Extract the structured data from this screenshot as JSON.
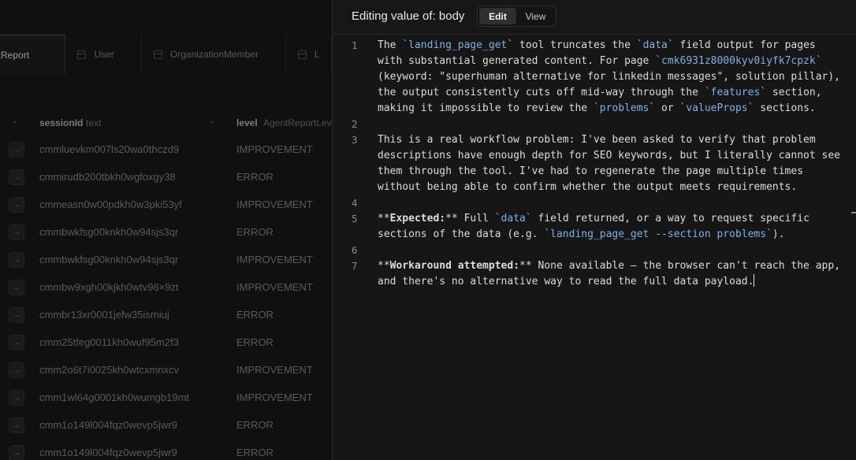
{
  "background": {
    "tabs": [
      {
        "label": "ntReport",
        "active": true
      },
      {
        "label": "User",
        "active": false
      },
      {
        "label": "OrganizationMember",
        "active": false
      },
      {
        "label": "L",
        "active": false
      }
    ],
    "columns": {
      "session_id": {
        "name": "sessionId",
        "type": "text"
      },
      "level": {
        "name": "level",
        "type": "AgentReportLev"
      }
    },
    "rows": [
      {
        "sessionId": "cmmluevkm007ls20wa0thczd9",
        "level": "IMPROVEMENT"
      },
      {
        "sessionId": "cmmirudb200tbkh0wgfoxgy38",
        "level": "ERROR"
      },
      {
        "sessionId": "cmmeasn0w00pdkh0w3pki53yf",
        "level": "IMPROVEMENT"
      },
      {
        "sessionId": "cmmbwkfsg00knkh0w94sjs3qr",
        "level": "ERROR"
      },
      {
        "sessionId": "cmmbwkfsg00knkh0w94sjs3qr",
        "level": "IMPROVEMENT"
      },
      {
        "sessionId": "cmmbw9xgh00kjkh0wtv96×9zt",
        "level": "IMPROVEMENT"
      },
      {
        "sessionId": "cmmbr13xr0001jefw35ismiuj",
        "level": "ERROR"
      },
      {
        "sessionId": "cmm25tfeg0011kh0wuf95m2f3",
        "level": "ERROR"
      },
      {
        "sessionId": "cmm2o6t7i0025kh0wtcxmnxcv",
        "level": "IMPROVEMENT"
      },
      {
        "sessionId": "cmm1wl64g0001kh0wumgb19mt",
        "level": "IMPROVEMENT"
      },
      {
        "sessionId": "cmm1o149l004fqz0wevp5jwr9",
        "level": "ERROR"
      },
      {
        "sessionId": "cmm1o149l004fqz0wevp5jwr9",
        "level": "ERROR"
      }
    ],
    "row_arrow_icon": "arrow-right-icon"
  },
  "editor": {
    "title": "Editing value of: body",
    "mode_edit_label": "Edit",
    "mode_view_label": "View",
    "active_mode": "Edit",
    "line_numbers": [
      "1",
      "2",
      "3",
      "4",
      "5",
      "6",
      "7"
    ],
    "accent_color": "#7fb0e8",
    "lines": [
      [
        {
          "t": "The "
        },
        {
          "t": "`landing_page_get`",
          "c": "tok"
        },
        {
          "t": " tool truncates the "
        },
        {
          "t": "`data`",
          "c": "tok"
        },
        {
          "t": " field output for pages"
        }
      ],
      [
        {
          "t": "with substantial generated content. For page "
        },
        {
          "t": "`cmk6931z8000kyv0iyfk7cpzk`",
          "c": "tok"
        }
      ],
      [
        {
          "t": "(keyword: \"superhuman alternative for linkedin messages\", solution pillar),"
        }
      ],
      [
        {
          "t": "the output consistently cuts off mid-way through the "
        },
        {
          "t": "`features`",
          "c": "tok"
        },
        {
          "t": " section,"
        }
      ],
      [
        {
          "t": "making it impossible to review the "
        },
        {
          "t": "`problems`",
          "c": "tok"
        },
        {
          "t": " or "
        },
        {
          "t": "`valueProps`",
          "c": "tok"
        },
        {
          "t": " sections."
        }
      ],
      [],
      [
        {
          "t": "This is a real workflow problem: I've been asked to verify that problem"
        }
      ],
      [
        {
          "t": "descriptions have enough depth for SEO keywords, but I literally cannot see"
        }
      ],
      [
        {
          "t": "them through the tool. I've had to regenerate the page multiple times"
        }
      ],
      [
        {
          "t": "without being able to confirm whether the output meets requirements."
        }
      ],
      [],
      [
        {
          "t": "**"
        },
        {
          "t": "Expected:",
          "c": "bold"
        },
        {
          "t": "** Full "
        },
        {
          "t": "`data`",
          "c": "tok"
        },
        {
          "t": " field returned, or a way to request specific"
        }
      ],
      [
        {
          "t": "sections of the data (e.g. "
        },
        {
          "t": "`landing_page_get --section problems`",
          "c": "tok"
        },
        {
          "t": ")."
        }
      ],
      [],
      [
        {
          "t": "**"
        },
        {
          "t": "Workaround attempted:",
          "c": "bold"
        },
        {
          "t": "** None available — the browser can't reach the app,"
        }
      ],
      [
        {
          "t": "and there's no alternative way to read the full data payload."
        },
        {
          "caret": true
        }
      ]
    ]
  }
}
